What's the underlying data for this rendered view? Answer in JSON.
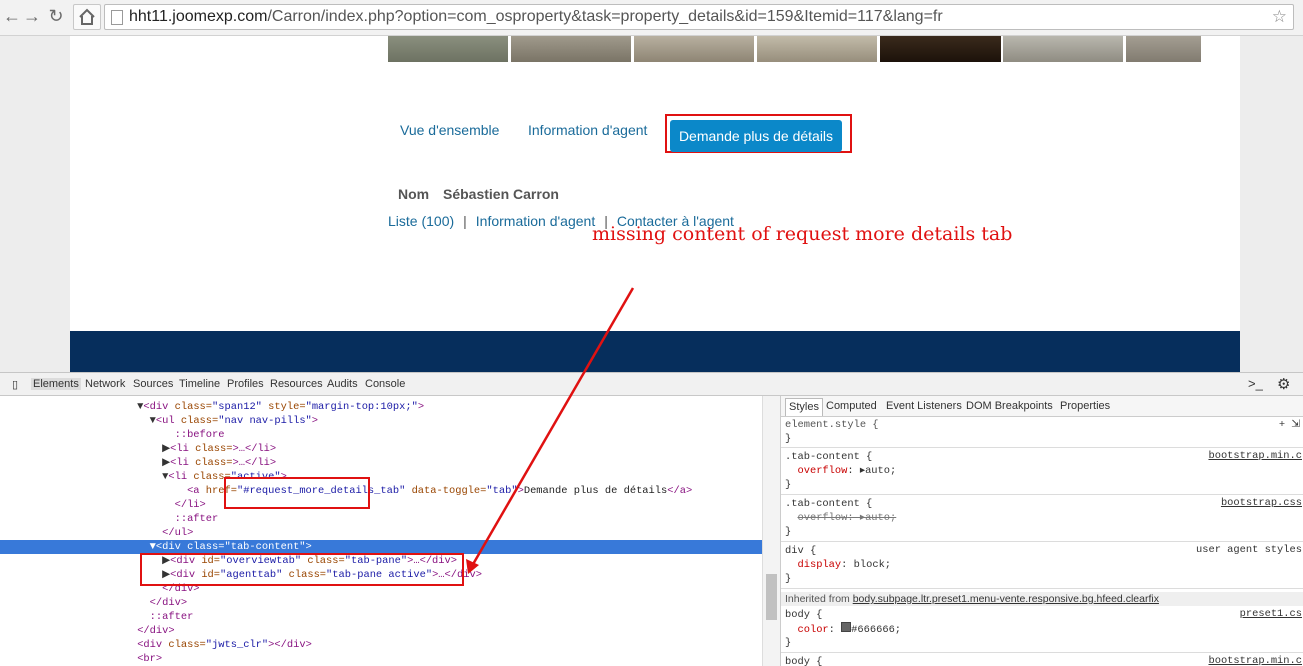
{
  "browser": {
    "url_host": "hht11.joomexp.com",
    "url_path": "/Carron/index.php?option=com_osproperty&task=property_details&id=159&Itemid=117&lang=fr"
  },
  "page": {
    "tabs": [
      {
        "label": "Vue d'ensemble"
      },
      {
        "label": "Information d'agent"
      },
      {
        "label": "Demande plus de détails"
      }
    ],
    "agent": {
      "name_label": "Nom",
      "name_value": "Sébastien Carron"
    },
    "links": [
      "Liste (100)",
      "Information d'agent",
      "Contacter à l'agent"
    ],
    "link_separator": "|",
    "colors": {
      "active_pill": "#0b88c9",
      "footer": "#062e5c",
      "annotation": "#e01111"
    }
  },
  "annotation": {
    "text": "missing  content of request more details tab"
  },
  "devtools": {
    "tabs": [
      "Elements",
      "Network",
      "Sources",
      "Timeline",
      "Profiles",
      "Resources",
      "Audits",
      "Console"
    ],
    "dom": {
      "l1_tag": "<div ",
      "l1_attr1": "class=",
      "l1_val1": "\"span12\"",
      "l1_attr2": " style=",
      "l1_val2": "\"margin-top:10px;\"",
      "l1_end": ">",
      "l2_tag": "<ul ",
      "l2_attr": "class=",
      "l2_val": "\"nav nav-pills\"",
      "l2_end": ">",
      "before": "::before",
      "li_tag": "<li ",
      "li_attr": "class=",
      "li_collapsed": ">…</li>",
      "li_active_val": "\"active\"",
      "a_tag": "<a ",
      "a_attr1": "href=",
      "a_val1": "\"#request_more_details_tab\"",
      "a_attr2": " data-toggle=",
      "a_val2": "\"tab\"",
      "a_text": "Demande plus de détails",
      "a_close": "</a>",
      "li_close": "</li>",
      "after": "::after",
      "ul_close": "</ul>",
      "tabcontent": "<div class=\"tab-content\">",
      "div_tag": "<div ",
      "id_attr": "id=",
      "class_attr": " class=",
      "overview_id": "\"overviewtab\"",
      "overview_class": "\"tab-pane\"",
      "agent_id": "\"agenttab\"",
      "agent_class": "\"tab-pane active\"",
      "collapsed_div": ">…</div>",
      "div_close": "</div>",
      "jwts_attr": "class=",
      "jwts_val": "\"jwts_clr\"",
      "jwts_end": "></div>",
      "br": "<br>"
    },
    "styles": {
      "sub_tabs": [
        "Styles",
        "Computed",
        "Event Listeners",
        "DOM Breakpoints",
        "Properties"
      ],
      "element_style": "element.style {",
      "close_brace": "}",
      "rule1_selector": ".tab-content {",
      "rule1_prop": "overflow",
      "rule1_val": "auto;",
      "rule1_src": "bootstrap.min.c",
      "rule2_selector": ".tab-content {",
      "rule2_prop": "overflow",
      "rule2_val": "auto;",
      "rule2_src": "bootstrap.css",
      "rule3_selector": "div {",
      "rule3_prop": "display",
      "rule3_val": "block;",
      "rule3_src": "user agent styles",
      "inherited_label": "Inherited from ",
      "inherited_from": "body.subpage.ltr.preset1.menu-vente.responsive.bg.hfeed.clearfix",
      "rule4_selector": "body {",
      "rule4_prop": "color",
      "rule4_val": "#666666;",
      "rule4_src": "preset1.cs",
      "rule5_selector": "body {",
      "rule5_src": "bootstrap.min.c"
    }
  }
}
